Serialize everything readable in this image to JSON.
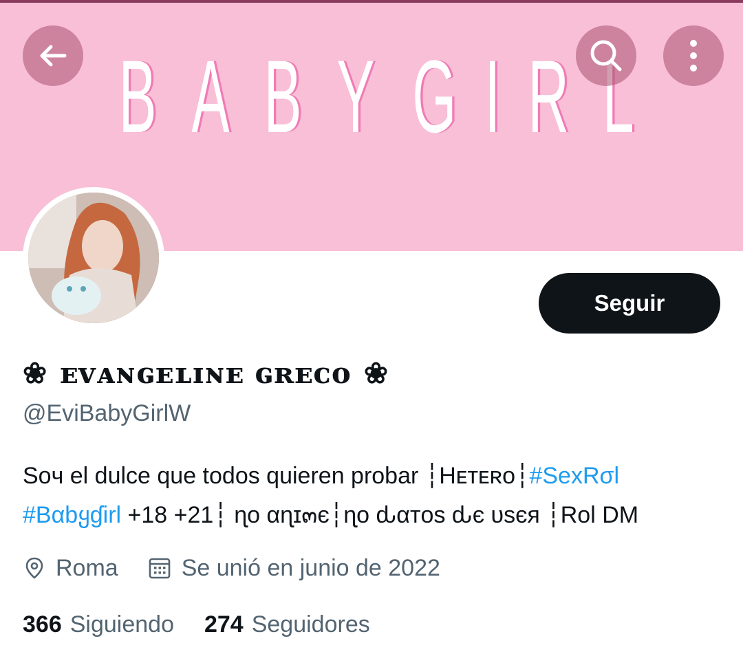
{
  "header": {
    "banner_text": "BABYGIRL",
    "back_icon": "arrow-left-icon",
    "search_icon": "search-icon",
    "more_icon": "more-vertical-icon"
  },
  "profile": {
    "display_name": "ᴇᴠᴀɴɢᴇʟɪɴᴇ ɢʀᴇᴄᴏ",
    "name_ornament": "❀",
    "handle": "@EviBabyGirlW",
    "follow_label": "Seguir"
  },
  "bio": {
    "part1": "Soч el dulce que todos quieren probar ┆Hᴇᴛᴇʀᴏ┆",
    "tag1": "#SexRσl",
    "tag2": "#Bαbყɠirl",
    "part2": " +18 +21┆ ɳo αɳɪ๓є┆ɳo ԃαтos ԃє υsєя ┆Rol DM"
  },
  "meta": {
    "location": "Roma",
    "joined": "Se unió en junio de 2022",
    "location_icon": "location-pin-icon",
    "calendar_icon": "calendar-icon"
  },
  "stats": {
    "following_count": "366",
    "following_label": "Siguiendo",
    "followers_count": "274",
    "followers_label": "Seguidores"
  },
  "colors": {
    "banner": "#f8bfd7",
    "banner_text_shadow": "#f07bb5",
    "link": "#1d9bf0",
    "secondary_text": "#536471",
    "primary_text": "#0f1419"
  }
}
